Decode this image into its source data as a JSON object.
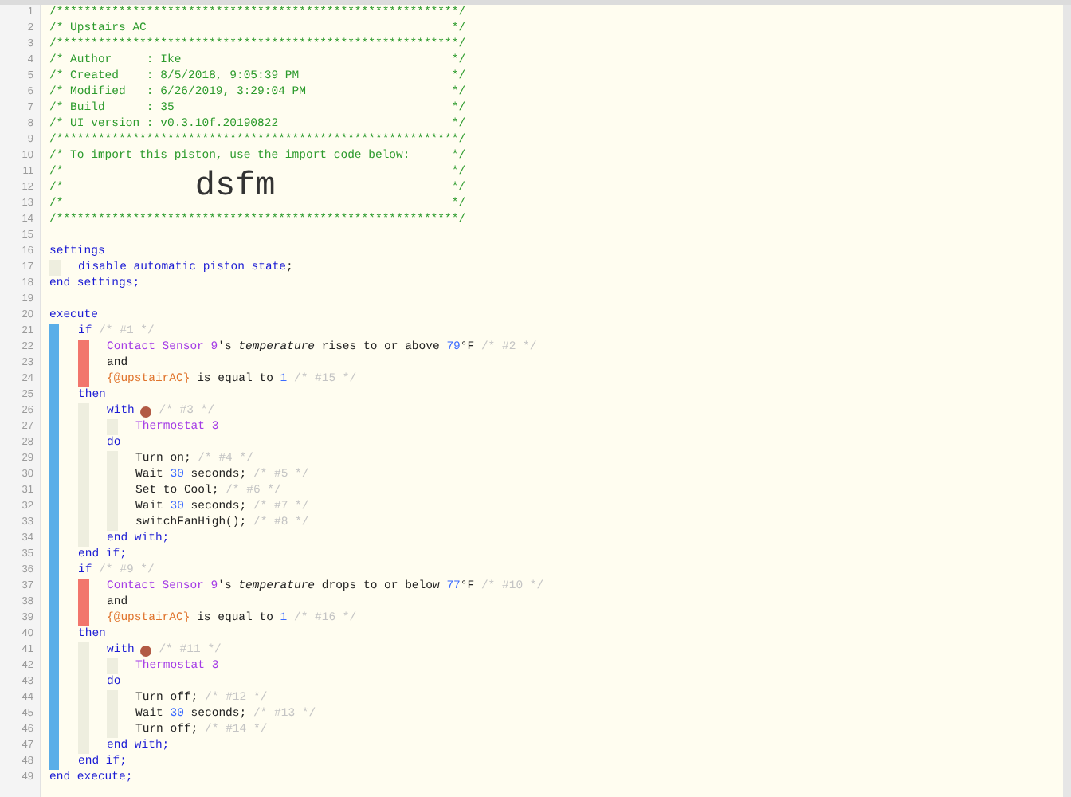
{
  "lines": [
    {
      "no": "1",
      "tokens": [
        {
          "kind": "comment",
          "text": "/**********************************************************/"
        }
      ]
    },
    {
      "no": "2",
      "tokens": [
        {
          "kind": "comment",
          "text": "/* Upstairs AC                                            */"
        }
      ]
    },
    {
      "no": "3",
      "tokens": [
        {
          "kind": "comment",
          "text": "/**********************************************************/"
        }
      ]
    },
    {
      "no": "4",
      "tokens": [
        {
          "kind": "comment",
          "text": "/* Author     : Ike                                       */"
        }
      ]
    },
    {
      "no": "5",
      "tokens": [
        {
          "kind": "comment",
          "text": "/* Created    : 8/5/2018, 9:05:39 PM                      */"
        }
      ]
    },
    {
      "no": "6",
      "tokens": [
        {
          "kind": "comment",
          "text": "/* Modified   : 6/26/2019, 3:29:04 PM                     */"
        }
      ]
    },
    {
      "no": "7",
      "tokens": [
        {
          "kind": "comment",
          "text": "/* Build      : 35                                        */"
        }
      ]
    },
    {
      "no": "8",
      "tokens": [
        {
          "kind": "comment",
          "text": "/* UI version : v0.3.10f.20190822                         */"
        }
      ]
    },
    {
      "no": "9",
      "tokens": [
        {
          "kind": "comment",
          "text": "/**********************************************************/"
        }
      ]
    },
    {
      "no": "10",
      "tokens": [
        {
          "kind": "comment",
          "text": "/* To import this piston, use the import code below:      */"
        }
      ]
    },
    {
      "no": "11",
      "tokens": [
        {
          "kind": "comment",
          "text": "/*                                                        */"
        }
      ]
    },
    {
      "no": "12",
      "tokens": [
        {
          "kind": "comment",
          "text": "/*"
        },
        {
          "kind": "import-code",
          "text": "dsfm",
          "attached": true
        },
        {
          "kind": "comment",
          "text": "*/",
          "attached": true
        }
      ]
    },
    {
      "no": "13",
      "tokens": [
        {
          "kind": "comment",
          "text": "/*                                                        */"
        }
      ]
    },
    {
      "no": "14",
      "tokens": [
        {
          "kind": "comment",
          "text": "/**********************************************************/"
        }
      ]
    },
    {
      "no": "15"
    },
    {
      "no": "16",
      "tokens": [
        {
          "kind": "keyword",
          "text": "settings"
        }
      ],
      "kind": "tasks",
      "children": [
        {
          "no": "17",
          "tokens": [
            {
              "kind": "keyword",
              "text": "disable automatic piston state"
            },
            {
              "kind": "text",
              "text": ";",
              "attached": true
            }
          ]
        }
      ]
    },
    {
      "no": "18",
      "tokens": [
        {
          "kind": "keyword",
          "text": "end settings;"
        }
      ]
    },
    {
      "no": "19"
    },
    {
      "no": "20",
      "tokens": [
        {
          "kind": "keyword",
          "text": "execute"
        }
      ],
      "kind": "statements",
      "children": [
        {
          "no": "21",
          "tokens": [
            {
              "kind": "keyword",
              "text": "if"
            },
            {
              "kind": "note",
              "text": "/* #1 */"
            }
          ],
          "kind": "conditions",
          "children": [
            {
              "no": "22",
              "tokens": [
                {
                  "kind": "device",
                  "text": "Contact Sensor 9"
                },
                {
                  "kind": "text",
                  "text": "'s",
                  "attached": true
                },
                {
                  "kind": "attribute",
                  "text": "temperature"
                },
                {
                  "kind": "text",
                  "text": "rises to or above"
                },
                {
                  "kind": "number",
                  "text": "79"
                },
                {
                  "kind": "text",
                  "text": "°F",
                  "attached": true
                },
                {
                  "kind": "note",
                  "text": "/* #2 */"
                }
              ]
            },
            {
              "no": "23",
              "tokens": [
                {
                  "kind": "text",
                  "text": "and"
                }
              ]
            },
            {
              "no": "24",
              "tokens": [
                {
                  "kind": "variable",
                  "text": "{@upstairAC}"
                },
                {
                  "kind": "text",
                  "text": "is equal to"
                },
                {
                  "kind": "number",
                  "text": "1"
                },
                {
                  "kind": "note",
                  "text": "/* #15 */"
                }
              ]
            }
          ]
        },
        {
          "no": "25",
          "tokens": [
            {
              "kind": "keyword",
              "text": "then"
            }
          ],
          "kind": "tasks",
          "children": [
            {
              "no": "26",
              "tokens": [
                {
                  "kind": "keyword",
                  "text": "with"
                },
                {
                  "kind": "icon"
                },
                {
                  "kind": "note",
                  "text": "/* #3 */"
                }
              ],
              "kind": "tasks",
              "children": [
                {
                  "no": "27",
                  "tokens": [
                    {
                      "kind": "device",
                      "text": "Thermostat 3"
                    }
                  ]
                }
              ]
            },
            {
              "no": "28",
              "tokens": [
                {
                  "kind": "keyword",
                  "text": "do"
                }
              ],
              "kind": "tasks",
              "children": [
                {
                  "no": "29",
                  "tokens": [
                    {
                      "kind": "text",
                      "text": "Turn on;"
                    },
                    {
                      "kind": "note",
                      "text": "/* #4 */"
                    }
                  ]
                },
                {
                  "no": "30",
                  "tokens": [
                    {
                      "kind": "text",
                      "text": "Wait"
                    },
                    {
                      "kind": "number",
                      "text": "30"
                    },
                    {
                      "kind": "text",
                      "text": "seconds;"
                    },
                    {
                      "kind": "note",
                      "text": "/* #5 */"
                    }
                  ]
                },
                {
                  "no": "31",
                  "tokens": [
                    {
                      "kind": "text",
                      "text": "Set to Cool;"
                    },
                    {
                      "kind": "note",
                      "text": "/* #6 */"
                    }
                  ]
                },
                {
                  "no": "32",
                  "tokens": [
                    {
                      "kind": "text",
                      "text": "Wait"
                    },
                    {
                      "kind": "number",
                      "text": "30"
                    },
                    {
                      "kind": "text",
                      "text": "seconds;"
                    },
                    {
                      "kind": "note",
                      "text": "/* #7 */"
                    }
                  ]
                },
                {
                  "no": "33",
                  "tokens": [
                    {
                      "kind": "text",
                      "text": "switchFanHigh();"
                    },
                    {
                      "kind": "note",
                      "text": "/* #8 */"
                    }
                  ]
                }
              ]
            },
            {
              "no": "34",
              "tokens": [
                {
                  "kind": "keyword",
                  "text": "end with;"
                }
              ]
            }
          ]
        },
        {
          "no": "35",
          "tokens": [
            {
              "kind": "keyword",
              "text": "end if;"
            }
          ]
        },
        {
          "no": "36",
          "tokens": [
            {
              "kind": "keyword",
              "text": "if"
            },
            {
              "kind": "note",
              "text": "/* #9 */"
            }
          ],
          "kind": "conditions",
          "children": [
            {
              "no": "37",
              "tokens": [
                {
                  "kind": "device",
                  "text": "Contact Sensor 9"
                },
                {
                  "kind": "text",
                  "text": "'s",
                  "attached": true
                },
                {
                  "kind": "attribute",
                  "text": "temperature"
                },
                {
                  "kind": "text",
                  "text": "drops to or below"
                },
                {
                  "kind": "number",
                  "text": "77"
                },
                {
                  "kind": "text",
                  "text": "°F",
                  "attached": true
                },
                {
                  "kind": "note",
                  "text": "/* #10 */"
                }
              ]
            },
            {
              "no": "38",
              "tokens": [
                {
                  "kind": "text",
                  "text": "and"
                }
              ]
            },
            {
              "no": "39",
              "tokens": [
                {
                  "kind": "variable",
                  "text": "{@upstairAC}"
                },
                {
                  "kind": "text",
                  "text": "is equal to"
                },
                {
                  "kind": "number",
                  "text": "1"
                },
                {
                  "kind": "note",
                  "text": "/* #16 */"
                }
              ]
            }
          ]
        },
        {
          "no": "40",
          "tokens": [
            {
              "kind": "keyword",
              "text": "then"
            }
          ],
          "kind": "tasks",
          "children": [
            {
              "no": "41",
              "tokens": [
                {
                  "kind": "keyword",
                  "text": "with"
                },
                {
                  "kind": "icon"
                },
                {
                  "kind": "note",
                  "text": "/* #11 */"
                }
              ],
              "kind": "tasks",
              "children": [
                {
                  "no": "42",
                  "tokens": [
                    {
                      "kind": "device",
                      "text": "Thermostat 3"
                    }
                  ]
                }
              ]
            },
            {
              "no": "43",
              "tokens": [
                {
                  "kind": "keyword",
                  "text": "do"
                }
              ],
              "kind": "tasks",
              "children": [
                {
                  "no": "44",
                  "tokens": [
                    {
                      "kind": "text",
                      "text": "Turn off;"
                    },
                    {
                      "kind": "note",
                      "text": "/* #12 */"
                    }
                  ]
                },
                {
                  "no": "45",
                  "tokens": [
                    {
                      "kind": "text",
                      "text": "Wait"
                    },
                    {
                      "kind": "number",
                      "text": "30"
                    },
                    {
                      "kind": "text",
                      "text": "seconds;"
                    },
                    {
                      "kind": "note",
                      "text": "/* #13 */"
                    }
                  ]
                },
                {
                  "no": "46",
                  "tokens": [
                    {
                      "kind": "text",
                      "text": "Turn off;"
                    },
                    {
                      "kind": "note",
                      "text": "/* #14 */"
                    }
                  ]
                }
              ]
            },
            {
              "no": "47",
              "tokens": [
                {
                  "kind": "keyword",
                  "text": "end with;"
                }
              ]
            }
          ]
        },
        {
          "no": "48",
          "tokens": [
            {
              "kind": "keyword",
              "text": "end if;"
            }
          ]
        }
      ]
    },
    {
      "no": "49",
      "tokens": [
        {
          "kind": "keyword",
          "text": "end execute;"
        }
      ]
    }
  ]
}
